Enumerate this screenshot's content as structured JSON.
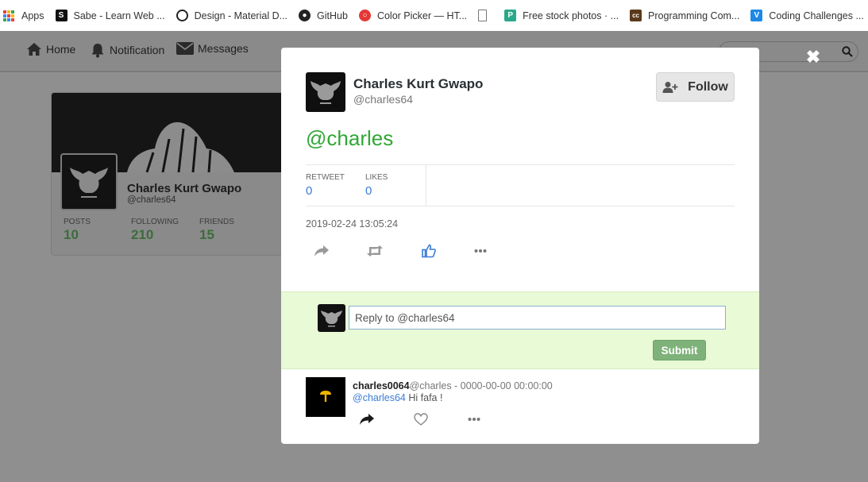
{
  "bookmarks": [
    {
      "label": "Apps",
      "icon": "apps-grid-icon"
    },
    {
      "label": "Sabe - Learn Web ...",
      "icon": "sabe-icon"
    },
    {
      "label": "Design - Material D...",
      "icon": "material-icon"
    },
    {
      "label": "GitHub",
      "icon": "github-icon"
    },
    {
      "label": "Color Picker — HT...",
      "icon": "color-picker-icon"
    },
    {
      "label": "",
      "icon": "page-icon"
    },
    {
      "label": "Free stock photos · ...",
      "icon": "stock-photos-icon"
    },
    {
      "label": "Programming Com...",
      "icon": "programming-icon"
    },
    {
      "label": "Coding Challenges ...",
      "icon": "coding-challenges-icon"
    }
  ],
  "nav": {
    "home": "Home",
    "notification": "Notification",
    "messages": "Messages"
  },
  "profile": {
    "name": "Charles Kurt Gwapo",
    "handle": "@charles64",
    "stats": [
      {
        "label": "POSTS",
        "value": "10"
      },
      {
        "label": "FOLLOWING",
        "value": "210"
      },
      {
        "label": "FRIENDS",
        "value": "15"
      }
    ]
  },
  "modal": {
    "close": "✖",
    "name": "Charles Kurt Gwapo",
    "handle": "@charles64",
    "follow_label": "Follow",
    "tweet_text": "@charles",
    "retweet_label": "RETWEET",
    "retweet_count": "0",
    "likes_label": "LIKES",
    "likes_count": "0",
    "date": "2019-02-24 13:05:24",
    "reply_placeholder": "Reply to @charles64",
    "submit_label": "Submit"
  },
  "comment": {
    "user": "charles0064",
    "meta": "@charles - 0000-00-00 00:00:00",
    "mention": "@charles64",
    "text": "Hi fafa !"
  },
  "colors": {
    "accent_green": "#2fa735",
    "link_blue": "#3a7bd5",
    "reply_bg": "#e9fad6",
    "submit_green": "#7fb27a"
  }
}
